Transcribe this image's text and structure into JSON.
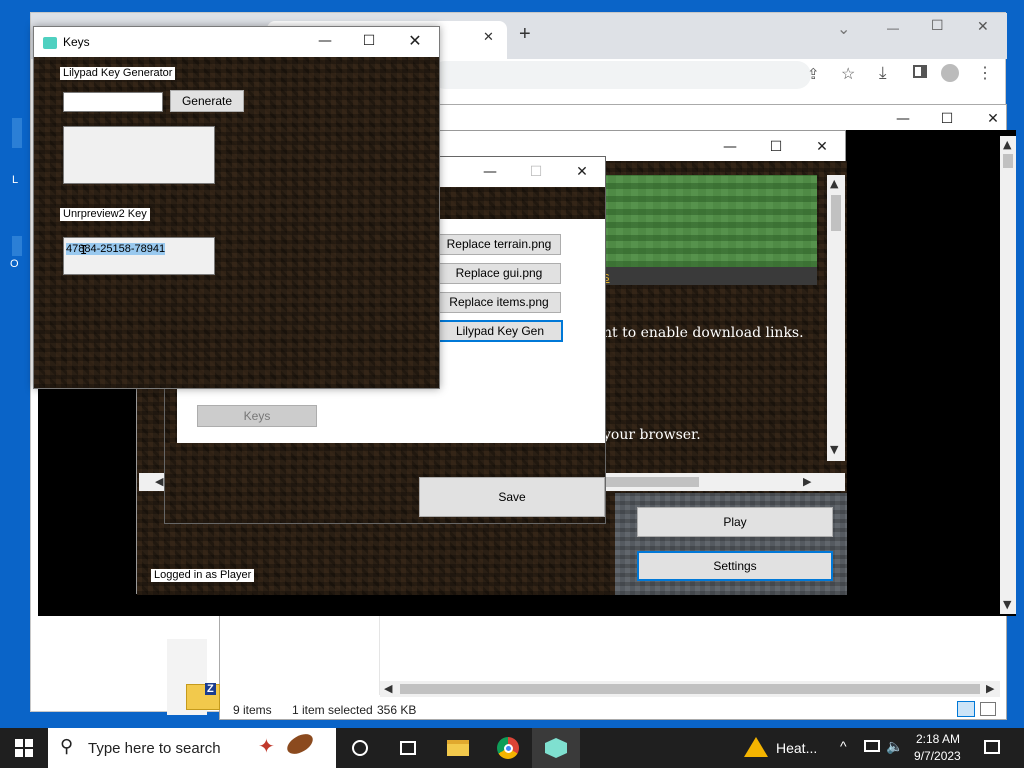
{
  "desktop": {
    "left_icon_labels": [
      "L",
      "O"
    ],
    "file_icon_text": "Z"
  },
  "browser": {
    "new_tab": "+",
    "controls": {
      "dropdown": "⌄",
      "minimize": "—",
      "maximize": "☐",
      "close": "✕"
    },
    "tab_close": "✕"
  },
  "explorer": {
    "status": {
      "items": "9 items",
      "selected": "1 item selected",
      "size": "356 KB"
    }
  },
  "launcher": {
    "page_text_1": "nt to enable download links.",
    "page_text_2": "your browser.",
    "link_fragment": "s",
    "logged_in": "Logged in as Player",
    "play": "Play",
    "settings": "Settings"
  },
  "settings_dialog": {
    "buttons": [
      "Replace terrain.png",
      "Replace gui.png",
      "Replace items.png",
      "Lilypad Key Gen"
    ],
    "keys": "Keys",
    "save": "Save"
  },
  "keys_window": {
    "title": "Keys",
    "generator_label": "Lilypad Key Generator",
    "generate": "Generate",
    "generator_input": "",
    "unrpreview_label": "Unrpreview2 Key",
    "key_value": "47884-25158-78941"
  },
  "taskbar": {
    "search_placeholder": "Type here to search",
    "weather": "Heat...",
    "time": "2:18 AM",
    "date": "9/7/2023",
    "accent": "#0078d7"
  }
}
